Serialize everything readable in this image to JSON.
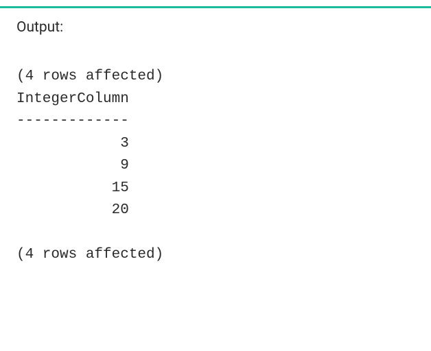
{
  "label": "Output:",
  "console": {
    "rows_affected_top": "(4 rows affected)",
    "column_header": "IntegerColumn",
    "separator": "-------------",
    "values": [
      "            3",
      "            9",
      "           15",
      "           20"
    ],
    "rows_affected_bottom": "(4 rows affected)"
  }
}
